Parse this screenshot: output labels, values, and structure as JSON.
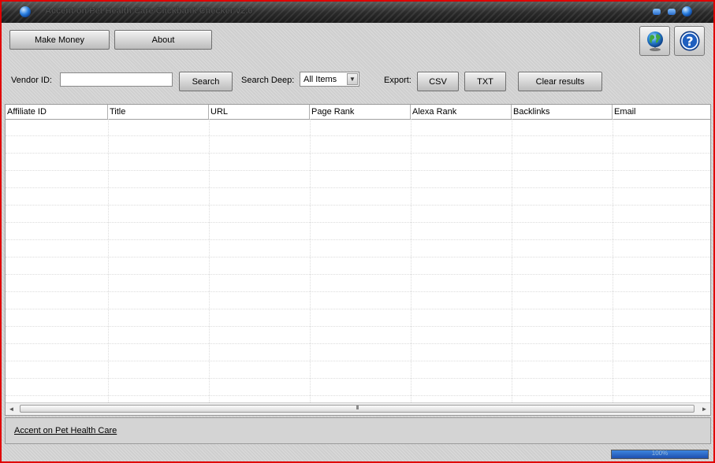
{
  "window": {
    "title": "Accent on Pet Health Care Clickbank Checker v2.0"
  },
  "toolbar": {
    "make_money_label": "Make Money",
    "about_label": "About",
    "globe_icon": "globe-icon",
    "help_icon": "help-icon"
  },
  "search": {
    "vendor_label": "Vendor ID:",
    "vendor_value": "",
    "search_label": "Search",
    "deep_label": "Search Deep:",
    "deep_selected": "All Items",
    "export_label": "Export:",
    "csv_label": "CSV",
    "txt_label": "TXT",
    "clear_label": "Clear results"
  },
  "grid": {
    "columns": [
      "Affiliate ID",
      "Title",
      "URL",
      "Page Rank",
      "Alexa Rank",
      "Backlinks",
      "Email"
    ],
    "rows": [],
    "scroll_thumb_grip": "III"
  },
  "footer": {
    "link_label": "Accent on Pet Health Care"
  },
  "status": {
    "progress_value": 1.0,
    "progress_text": "100%"
  },
  "colors": {
    "window_border": "#e00000",
    "accent_blue": "#2a7fe0"
  }
}
